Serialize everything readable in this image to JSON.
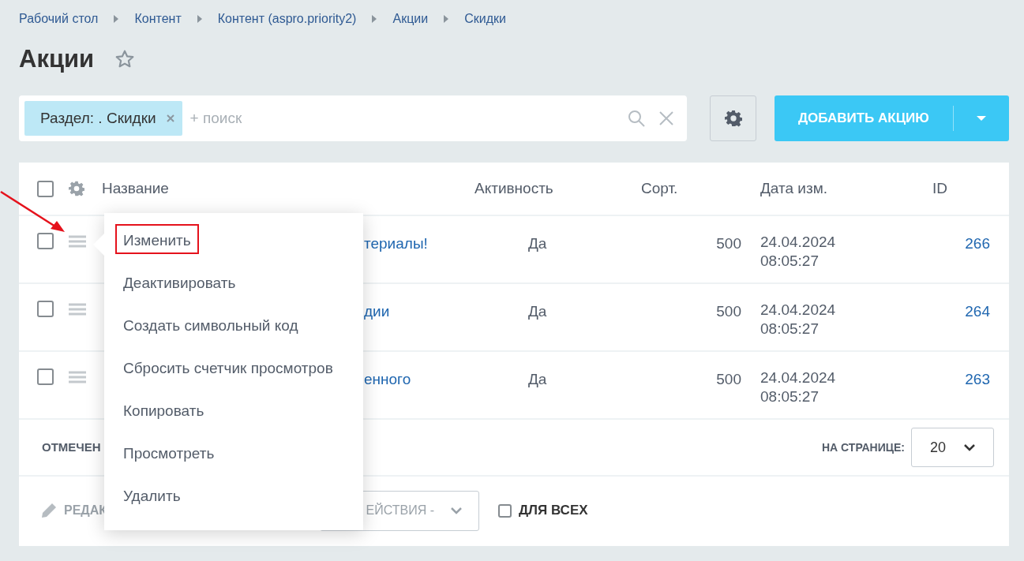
{
  "breadcrumbs": [
    {
      "label": "Рабочий стол"
    },
    {
      "label": "Контент"
    },
    {
      "label": "Контент (aspro.priority2)"
    },
    {
      "label": "Акции"
    },
    {
      "label": "Скидки"
    }
  ],
  "title": "Акции",
  "favorite": false,
  "filter": {
    "tags": [
      {
        "label": "Раздел: . Скидки"
      }
    ],
    "placeholder": "+ поиск"
  },
  "add_button": "ДОБАВИТЬ АКЦИЮ",
  "table": {
    "all_checked": false,
    "columns": [
      "Название",
      "Активность",
      "Сорт.",
      "Дата изм.",
      "ID"
    ],
    "rows": [
      {
        "checked": false,
        "name": "териалы!",
        "active": "Да",
        "sort": "500",
        "date": "24.04.2024 08:05:27",
        "id": "266"
      },
      {
        "checked": false,
        "name": "дии",
        "active": "Да",
        "sort": "500",
        "date": "24.04.2024 08:05:27",
        "id": "264"
      },
      {
        "checked": false,
        "name": "енного",
        "active": "Да",
        "sort": "500",
        "date": "24.04.2024 08:05:27",
        "id": "263"
      }
    ]
  },
  "footer": {
    "marked_label": "ОТМЕЧЕН",
    "per_page_label": "НА СТРАНИЦЕ:",
    "per_page": "20",
    "edit_label": "РЕДАК",
    "actions_select": "ЕЙСТВИЯ -",
    "for_all": {
      "label": "ДЛЯ ВСЕХ",
      "checked": false
    }
  },
  "context_menu": {
    "items": [
      {
        "label": "Изменить",
        "highlighted": true
      },
      {
        "label": "Деактивировать",
        "highlighted": false
      },
      {
        "label": "Создать символьный код",
        "highlighted": false
      },
      {
        "label": "Сбросить счетчик просмотров",
        "highlighted": false
      },
      {
        "label": "Копировать",
        "highlighted": false
      },
      {
        "label": "Просмотреть",
        "highlighted": false
      },
      {
        "label": "Удалить",
        "highlighted": false
      }
    ]
  }
}
